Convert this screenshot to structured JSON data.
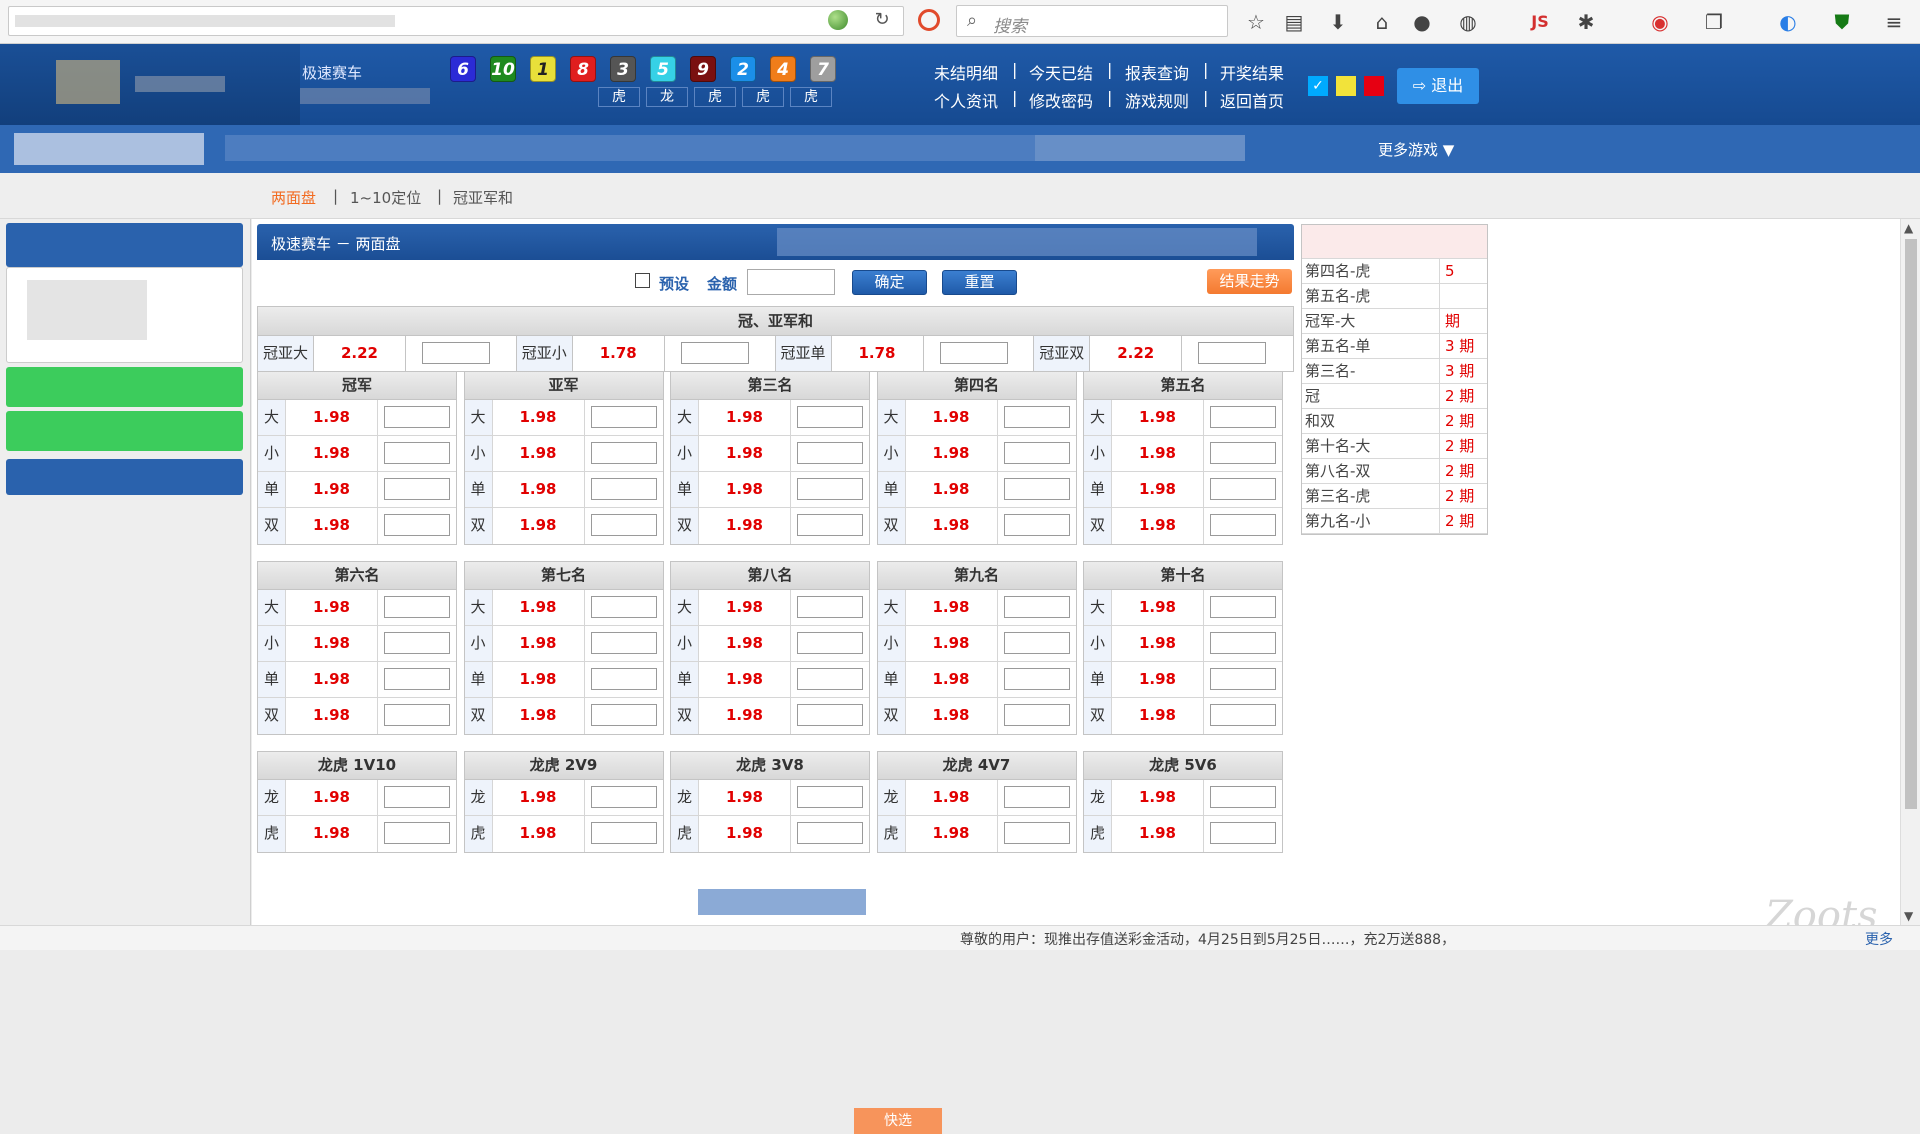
{
  "browser": {
    "search_placeholder": "搜索",
    "js_label": "JS"
  },
  "header": {
    "game_title": "极速赛车",
    "balls": [
      {
        "num": "6",
        "color": "#2b2bd6"
      },
      {
        "num": "10",
        "color": "#1f8a1f"
      },
      {
        "num": "1",
        "color": "#e8e03a"
      },
      {
        "num": "8",
        "color": "#e01e1e"
      },
      {
        "num": "3",
        "color": "#555555"
      },
      {
        "num": "5",
        "color": "#36d1e6"
      },
      {
        "num": "9",
        "color": "#7a1010"
      },
      {
        "num": "2",
        "color": "#1b8fe8"
      },
      {
        "num": "4",
        "color": "#f07d1a"
      },
      {
        "num": "7",
        "color": "#9e9e9e"
      }
    ],
    "dragon_tiger": [
      "虎",
      "龙",
      "虎",
      "虎",
      "虎"
    ],
    "links_row1": [
      "未结明细",
      "今天已结",
      "报表查询",
      "开奖结果"
    ],
    "links_row2": [
      "个人资讯",
      "修改密码",
      "游戏规则",
      "返回首页"
    ],
    "theme_colors": [
      "#00aaff",
      "#f2e33a",
      "#e60012"
    ],
    "logout_label": "退出"
  },
  "nav": {
    "more_games": "更多游戏 ▼"
  },
  "sub_tabs": [
    "两面盘",
    "1~10定位",
    "冠亚军和"
  ],
  "content": {
    "title": "极速赛车 － 两面盘",
    "preset_label": "预设",
    "amount_label": "金额",
    "confirm_label": "确定",
    "reset_label": "重置",
    "trend_label": "结果走势",
    "sum_section": {
      "title": "冠、亚军和",
      "items": [
        {
          "label": "冠亚大",
          "odds": "2.22"
        },
        {
          "label": "冠亚小",
          "odds": "1.78"
        },
        {
          "label": "冠亚单",
          "odds": "1.78"
        },
        {
          "label": "冠亚双",
          "odds": "2.22"
        }
      ]
    },
    "rank_blocks_row1": [
      {
        "title": "冠军",
        "rows": [
          {
            "label": "大",
            "odds": "1.98"
          },
          {
            "label": "小",
            "odds": "1.98"
          },
          {
            "label": "单",
            "odds": "1.98"
          },
          {
            "label": "双",
            "odds": "1.98"
          }
        ]
      },
      {
        "title": "亚军",
        "rows": [
          {
            "label": "大",
            "odds": "1.98"
          },
          {
            "label": "小",
            "odds": "1.98"
          },
          {
            "label": "单",
            "odds": "1.98"
          },
          {
            "label": "双",
            "odds": "1.98"
          }
        ]
      },
      {
        "title": "第三名",
        "rows": [
          {
            "label": "大",
            "odds": "1.98"
          },
          {
            "label": "小",
            "odds": "1.98"
          },
          {
            "label": "单",
            "odds": "1.98"
          },
          {
            "label": "双",
            "odds": "1.98"
          }
        ]
      },
      {
        "title": "第四名",
        "rows": [
          {
            "label": "大",
            "odds": "1.98"
          },
          {
            "label": "小",
            "odds": "1.98"
          },
          {
            "label": "单",
            "odds": "1.98"
          },
          {
            "label": "双",
            "odds": "1.98"
          }
        ]
      },
      {
        "title": "第五名",
        "rows": [
          {
            "label": "大",
            "odds": "1.98"
          },
          {
            "label": "小",
            "odds": "1.98"
          },
          {
            "label": "单",
            "odds": "1.98"
          },
          {
            "label": "双",
            "odds": "1.98"
          }
        ]
      }
    ],
    "rank_blocks_row2": [
      {
        "title": "第六名",
        "rows": [
          {
            "label": "大",
            "odds": "1.98"
          },
          {
            "label": "小",
            "odds": "1.98"
          },
          {
            "label": "单",
            "odds": "1.98"
          },
          {
            "label": "双",
            "odds": "1.98"
          }
        ]
      },
      {
        "title": "第七名",
        "rows": [
          {
            "label": "大",
            "odds": "1.98"
          },
          {
            "label": "小",
            "odds": "1.98"
          },
          {
            "label": "单",
            "odds": "1.98"
          },
          {
            "label": "双",
            "odds": "1.98"
          }
        ]
      },
      {
        "title": "第八名",
        "rows": [
          {
            "label": "大",
            "odds": "1.98"
          },
          {
            "label": "小",
            "odds": "1.98"
          },
          {
            "label": "单",
            "odds": "1.98"
          },
          {
            "label": "双",
            "odds": "1.98"
          }
        ]
      },
      {
        "title": "第九名",
        "rows": [
          {
            "label": "大",
            "odds": "1.98"
          },
          {
            "label": "小",
            "odds": "1.98"
          },
          {
            "label": "单",
            "odds": "1.98"
          },
          {
            "label": "双",
            "odds": "1.98"
          }
        ]
      },
      {
        "title": "第十名",
        "rows": [
          {
            "label": "大",
            "odds": "1.98"
          },
          {
            "label": "小",
            "odds": "1.98"
          },
          {
            "label": "单",
            "odds": "1.98"
          },
          {
            "label": "双",
            "odds": "1.98"
          }
        ]
      }
    ],
    "rank_blocks_row3": [
      {
        "title": "龙虎 1V10",
        "rows": [
          {
            "label": "龙",
            "odds": "1.98"
          },
          {
            "label": "虎",
            "odds": "1.98"
          }
        ]
      },
      {
        "title": "龙虎 2V9",
        "rows": [
          {
            "label": "龙",
            "odds": "1.98"
          },
          {
            "label": "虎",
            "odds": "1.98"
          }
        ]
      },
      {
        "title": "龙虎 3V8",
        "rows": [
          {
            "label": "龙",
            "odds": "1.98"
          },
          {
            "label": "虎",
            "odds": "1.98"
          }
        ]
      },
      {
        "title": "龙虎 4V7",
        "rows": [
          {
            "label": "龙",
            "odds": "1.98"
          },
          {
            "label": "虎",
            "odds": "1.98"
          }
        ]
      },
      {
        "title": "龙虎 5V6",
        "rows": [
          {
            "label": "龙",
            "odds": "1.98"
          },
          {
            "label": "虎",
            "odds": "1.98"
          }
        ]
      }
    ],
    "quick_bet_label": "快选"
  },
  "stats": [
    {
      "name": "第四名-虎",
      "count": "5"
    },
    {
      "name": "第五名-虎",
      "count": ""
    },
    {
      "name": "冠军-大",
      "count": "期"
    },
    {
      "name": "第五名-单",
      "count": "3 期"
    },
    {
      "name": "第三名-",
      "count": "3 期"
    },
    {
      "name": "冠",
      "count": "2 期"
    },
    {
      "name": "和双",
      "count": "2 期"
    },
    {
      "name": "第十名-大",
      "count": "2 期"
    },
    {
      "name": "第八名-双",
      "count": "2 期"
    },
    {
      "name": "第三名-虎",
      "count": "2 期"
    },
    {
      "name": "第九名-小",
      "count": "2 期"
    }
  ],
  "ticker": {
    "text": "尊敬的用户：现推出存值送彩金活动，4月25日到5月25日……，充2万送888，",
    "more": "更多"
  },
  "watermark": "Zoots"
}
